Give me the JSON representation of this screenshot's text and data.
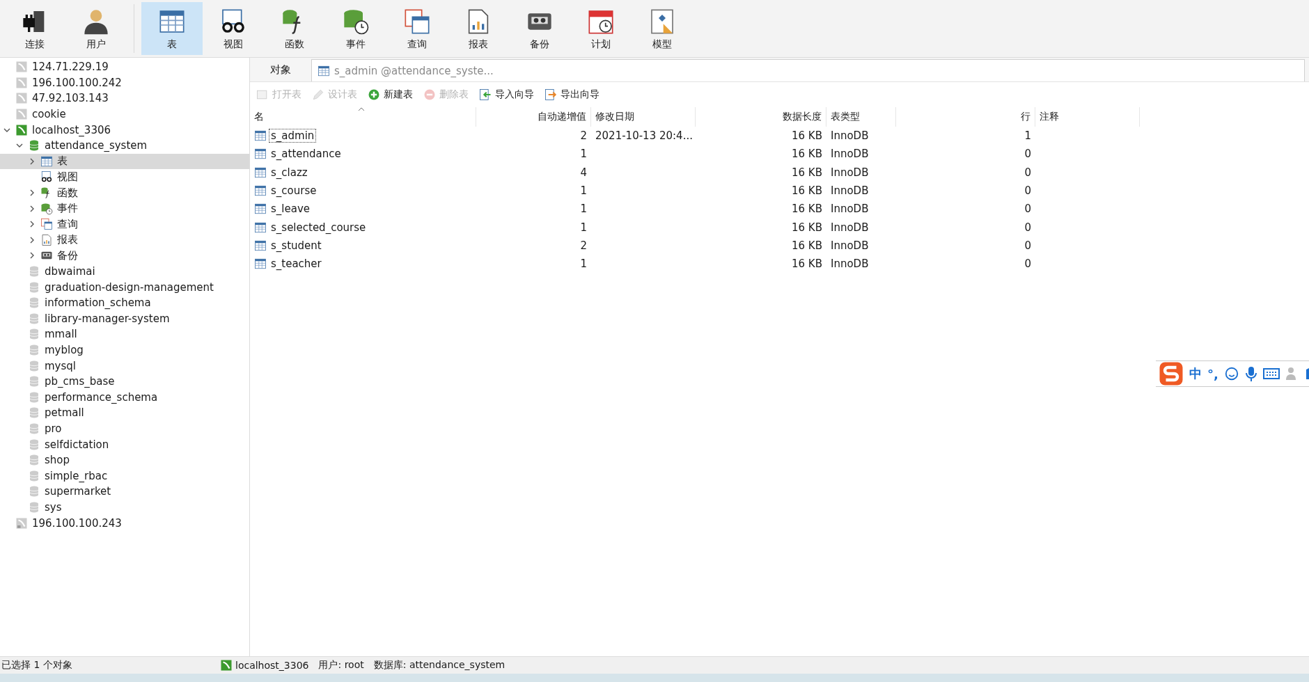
{
  "toolbar": [
    {
      "label": "连接",
      "kind": "connect",
      "selected": false
    },
    {
      "label": "用户",
      "kind": "user",
      "selected": false
    },
    {
      "label": "表",
      "kind": "table",
      "selected": true
    },
    {
      "label": "视图",
      "kind": "view",
      "selected": false
    },
    {
      "label": "函数",
      "kind": "function",
      "selected": false
    },
    {
      "label": "事件",
      "kind": "event",
      "selected": false
    },
    {
      "label": "查询",
      "kind": "query",
      "selected": false
    },
    {
      "label": "报表",
      "kind": "report",
      "selected": false
    },
    {
      "label": "备份",
      "kind": "backup",
      "selected": false
    },
    {
      "label": "计划",
      "kind": "schedule",
      "selected": false
    },
    {
      "label": "模型",
      "kind": "model",
      "selected": false
    }
  ],
  "sidebar": {
    "items": [
      {
        "label": "124.71.229.19",
        "kind": "server",
        "active": false,
        "selected": false
      },
      {
        "label": "196.100.100.242",
        "kind": "server",
        "active": false,
        "selected": false
      },
      {
        "label": "47.92.103.143",
        "kind": "server",
        "active": false,
        "selected": false
      },
      {
        "label": "cookie",
        "kind": "server",
        "active": false,
        "selected": false
      },
      {
        "label": "localhost_3306",
        "kind": "server",
        "active": true,
        "selected": false,
        "expanded": true,
        "children": [
          {
            "label": "attendance_system",
            "kind": "database",
            "active": true,
            "selected": false,
            "expanded": true,
            "children": [
              {
                "label": "表",
                "kind": "table",
                "selected": true,
                "expanded": false
              },
              {
                "label": "视图",
                "kind": "view",
                "selected": false
              },
              {
                "label": "函数",
                "kind": "function",
                "selected": false,
                "expanded": false
              },
              {
                "label": "事件",
                "kind": "event",
                "selected": false,
                "expanded": false
              },
              {
                "label": "查询",
                "kind": "query",
                "selected": false,
                "expanded": false
              },
              {
                "label": "报表",
                "kind": "report",
                "selected": false,
                "expanded": false
              },
              {
                "label": "备份",
                "kind": "backup",
                "selected": false,
                "expanded": false
              }
            ]
          },
          {
            "label": "dbwaimai",
            "kind": "database",
            "active": false,
            "selected": false
          },
          {
            "label": "graduation-design-management",
            "kind": "database",
            "active": false,
            "selected": false
          },
          {
            "label": "information_schema",
            "kind": "database",
            "active": false,
            "selected": false
          },
          {
            "label": "library-manager-system",
            "kind": "database",
            "active": false,
            "selected": false
          },
          {
            "label": "mmall",
            "kind": "database",
            "active": false,
            "selected": false
          },
          {
            "label": "myblog",
            "kind": "database",
            "active": false,
            "selected": false
          },
          {
            "label": "mysql",
            "kind": "database",
            "active": false,
            "selected": false
          },
          {
            "label": "pb_cms_base",
            "kind": "database",
            "active": false,
            "selected": false
          },
          {
            "label": "performance_schema",
            "kind": "database",
            "active": false,
            "selected": false
          },
          {
            "label": "petmall",
            "kind": "database",
            "active": false,
            "selected": false
          },
          {
            "label": "pro",
            "kind": "database",
            "active": false,
            "selected": false
          },
          {
            "label": "selfdictation",
            "kind": "database",
            "active": false,
            "selected": false
          },
          {
            "label": "shop",
            "kind": "database",
            "active": false,
            "selected": false
          },
          {
            "label": "simple_rbac",
            "kind": "database",
            "active": false,
            "selected": false
          },
          {
            "label": "supermarket",
            "kind": "database",
            "active": false,
            "selected": false
          },
          {
            "label": "sys",
            "kind": "database",
            "active": false,
            "selected": false
          }
        ]
      },
      {
        "label": "196.100.100.243",
        "kind": "server-alt",
        "selected": false
      }
    ]
  },
  "object_tabs": {
    "label": "对象",
    "tab": "s_admin @attendance_syste..."
  },
  "actions": [
    {
      "label": "打开表",
      "kind": "open",
      "disabled": true
    },
    {
      "label": "设计表",
      "kind": "design",
      "disabled": true
    },
    {
      "label": "新建表",
      "kind": "new",
      "disabled": false
    },
    {
      "label": "删除表",
      "kind": "delete",
      "disabled": true
    },
    {
      "label": "导入向导",
      "kind": "import",
      "disabled": false
    },
    {
      "label": "导出向导",
      "kind": "export",
      "disabled": false
    }
  ],
  "table": {
    "columns": [
      "名",
      "自动递增值",
      "修改日期",
      "数据长度",
      "表类型",
      "行",
      "注释"
    ],
    "rows": [
      {
        "cells": [
          "s_admin",
          "2",
          "2021-10-13 20:4...",
          "16 KB",
          "InnoDB",
          "1",
          ""
        ],
        "selected": true
      },
      {
        "cells": [
          "s_attendance",
          "1",
          "",
          "16 KB",
          "InnoDB",
          "0",
          ""
        ],
        "selected": false
      },
      {
        "cells": [
          "s_clazz",
          "4",
          "",
          "16 KB",
          "InnoDB",
          "0",
          ""
        ],
        "selected": false
      },
      {
        "cells": [
          "s_course",
          "1",
          "",
          "16 KB",
          "InnoDB",
          "0",
          ""
        ],
        "selected": false
      },
      {
        "cells": [
          "s_leave",
          "1",
          "",
          "16 KB",
          "InnoDB",
          "0",
          ""
        ],
        "selected": false
      },
      {
        "cells": [
          "s_selected_course",
          "1",
          "",
          "16 KB",
          "InnoDB",
          "0",
          ""
        ],
        "selected": false
      },
      {
        "cells": [
          "s_student",
          "2",
          "",
          "16 KB",
          "InnoDB",
          "0",
          ""
        ],
        "selected": false
      },
      {
        "cells": [
          "s_teacher",
          "1",
          "",
          "16 KB",
          "InnoDB",
          "0",
          ""
        ],
        "selected": false
      }
    ]
  },
  "ime": {
    "mode": "中",
    "punct": "°,"
  },
  "status_bar": {
    "selection": "已选择 1 个对象",
    "connection": "localhost_3306",
    "user": "用户: root",
    "database": "数据库: attendance_system"
  }
}
